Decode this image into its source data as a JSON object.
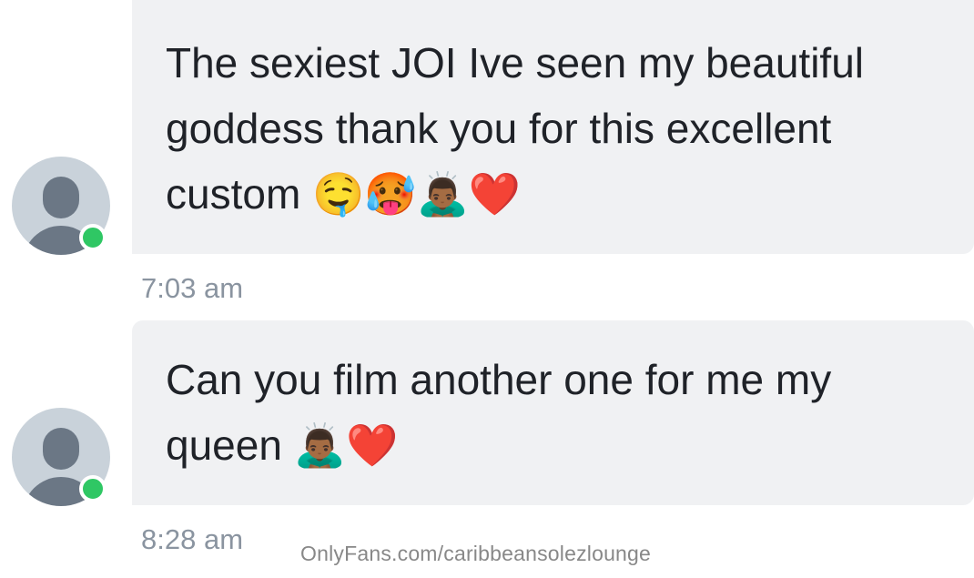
{
  "messages": [
    {
      "text": "The sexiest JOI Ive seen my beautiful goddess thank you for this excellent custom",
      "emojis": "🤤🥵🙇🏾‍♂️❤️",
      "time": "7:03 am",
      "sender_online": true
    },
    {
      "text": "Can you film another one for me my queen",
      "emojis": "🙇🏾‍♂️❤️",
      "time": "8:28 am",
      "sender_online": true
    }
  ],
  "watermark": "OnlyFans.com/caribbeansolezlounge",
  "colors": {
    "bubble_bg": "#f0f1f3",
    "online_dot": "#2fc764",
    "timestamp": "#8a94a0",
    "avatar_bg": "#c9d2da"
  }
}
